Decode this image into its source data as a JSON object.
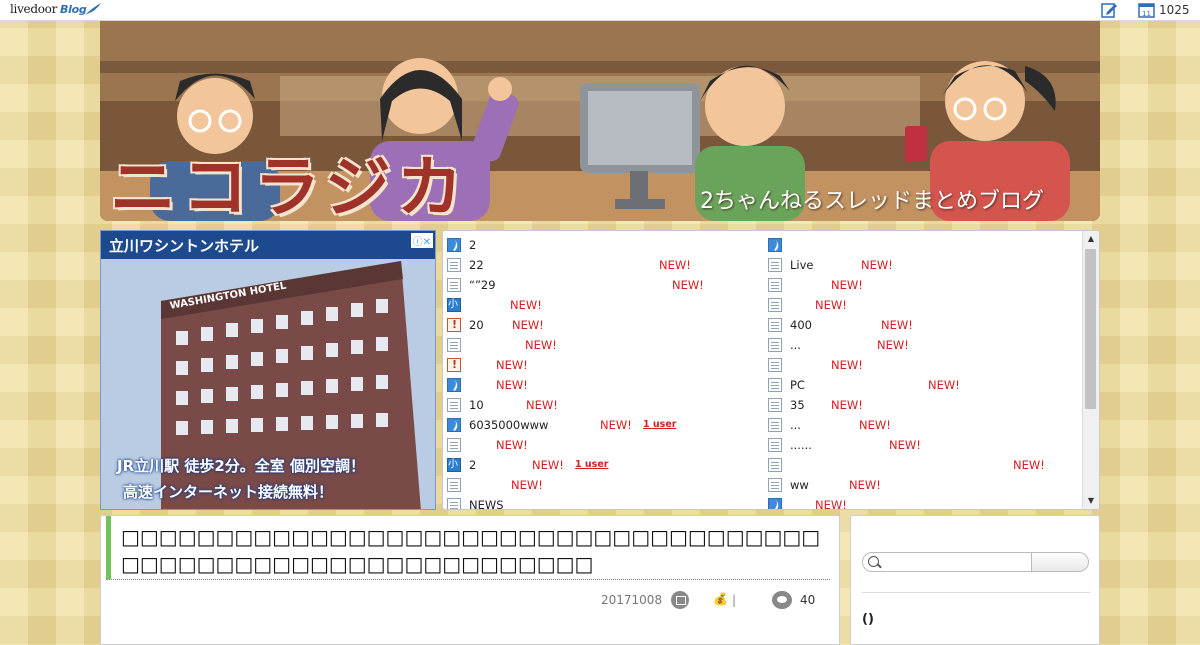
{
  "topbar": {
    "logo_text": "livedoor",
    "logo_blog": "Blog",
    "count": "1025",
    "icons": [
      "edit-icon",
      "calendar-icon"
    ]
  },
  "header": {
    "logo_text": "ニコラジカ",
    "subtitle": "2ちゃんねるスレッドまとめブログ"
  },
  "ad": {
    "choices": "ⓘ✕",
    "title": "立川ワシントンホテル",
    "building_sign": "WASHINGTON HOTEL",
    "line1": "JR立川駅 徒歩2分。全室 個別空調！",
    "line2": "高速インターネット接続無料！"
  },
  "feed": {
    "new_label": "NEW!",
    "left": [
      {
        "icon": "feather",
        "text": "2",
        "new_at": null,
        "users": null
      },
      {
        "icon": "page",
        "text": "22",
        "new_at": 190,
        "users": null
      },
      {
        "icon": "page",
        "text": "“”29",
        "new_at": 203,
        "users": null
      },
      {
        "icon": "small",
        "text": "",
        "new_at": 41,
        "users": null
      },
      {
        "icon": "warn",
        "text": "20",
        "new_at": 43,
        "users": null
      },
      {
        "icon": "page",
        "text": "",
        "new_at": 56,
        "users": null
      },
      {
        "icon": "warn",
        "text": "",
        "new_at": 27,
        "users": null
      },
      {
        "icon": "feather",
        "text": "",
        "new_at": 27,
        "users": null
      },
      {
        "icon": "page",
        "text": "10",
        "new_at": 57,
        "users": null
      },
      {
        "icon": "feather",
        "text": "6035000www",
        "new_at": 131,
        "users": "1 user",
        "users_at": 174
      },
      {
        "icon": "page",
        "text": "",
        "new_at": 27,
        "users": null
      },
      {
        "icon": "small",
        "text": "2",
        "new_at": 63,
        "users": "1 user",
        "users_at": 106
      },
      {
        "icon": "page",
        "text": "",
        "new_at": 42,
        "users": null
      },
      {
        "icon": "page",
        "text": "NEWS",
        "new_at": null,
        "users": null
      }
    ],
    "right": [
      {
        "icon": "feather",
        "text": "",
        "new_at": null,
        "users": null
      },
      {
        "icon": "page",
        "text": "Live",
        "new_at": 71,
        "users": null
      },
      {
        "icon": "page",
        "text": "",
        "new_at": 41,
        "users": null
      },
      {
        "icon": "page",
        "text": "",
        "new_at": 25,
        "users": null
      },
      {
        "icon": "page",
        "text": "400",
        "new_at": 91,
        "users": null
      },
      {
        "icon": "page",
        "text": "...",
        "new_at": 87,
        "users": null
      },
      {
        "icon": "page",
        "text": "",
        "new_at": 41,
        "users": null
      },
      {
        "icon": "page",
        "text": "PC",
        "new_at": 138,
        "users": null
      },
      {
        "icon": "page",
        "text": "35",
        "new_at": 41,
        "users": null
      },
      {
        "icon": "page",
        "text": " ...",
        "new_at": 69,
        "users": null
      },
      {
        "icon": "page",
        "text": "......",
        "new_at": 99,
        "users": null
      },
      {
        "icon": "page",
        "text": "",
        "new_at": 223,
        "users": null
      },
      {
        "icon": "page",
        "text": "ww",
        "new_at": 59,
        "users": null
      },
      {
        "icon": "feather",
        "text": "",
        "new_at": 25,
        "users": null
      }
    ]
  },
  "article": {
    "title": "□□□□□□□□□□□□□□□□□□□□□□□□□□□□□□□□□□□□□□□□□□□□□□□□□□□□□□□□□□□□□□",
    "date": "20171008",
    "coin": "💰",
    "separator": "|",
    "comment_count": "40"
  },
  "sidebar": {
    "search_placeholder": "",
    "section_heading": "()"
  }
}
